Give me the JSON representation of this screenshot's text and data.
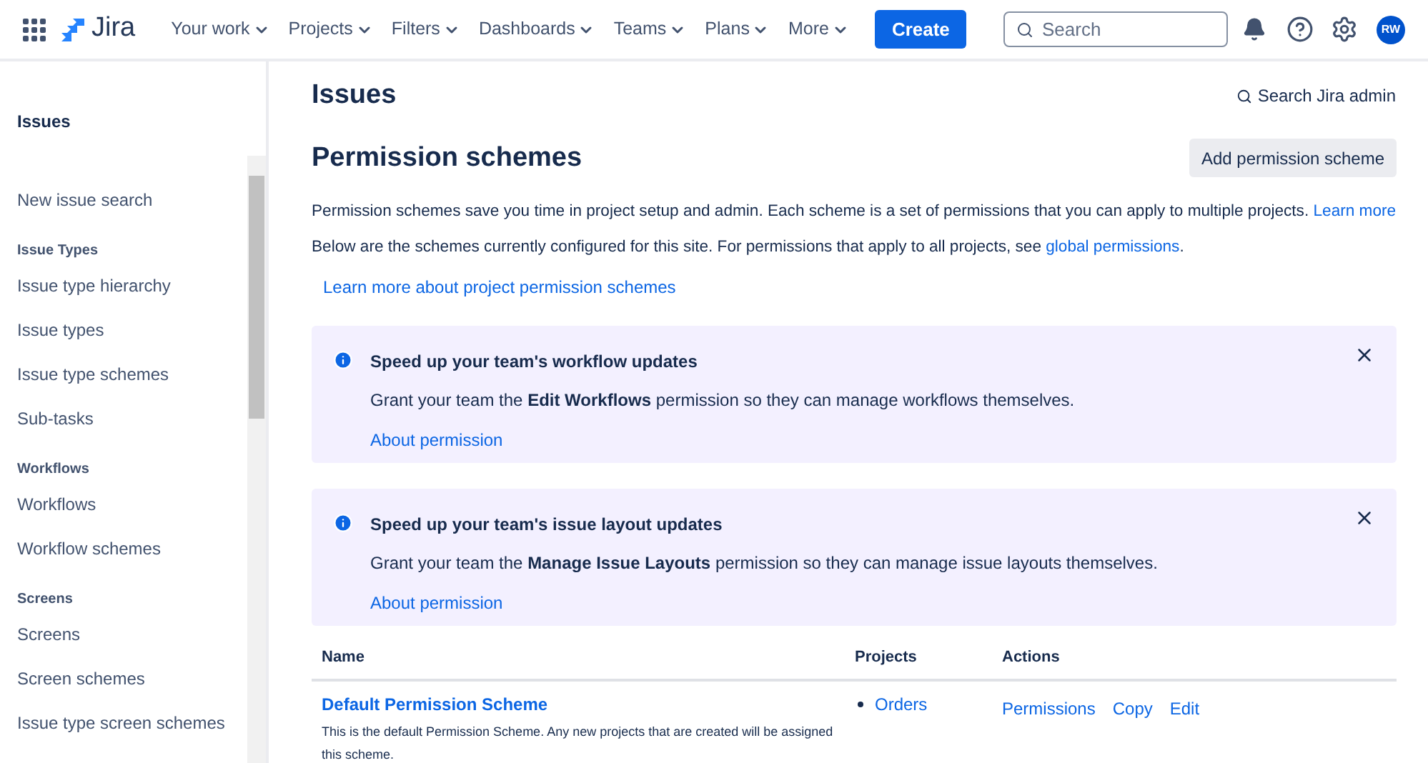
{
  "topbar": {
    "product": "Jira",
    "nav": [
      {
        "label": "Your work"
      },
      {
        "label": "Projects"
      },
      {
        "label": "Filters"
      },
      {
        "label": "Dashboards"
      },
      {
        "label": "Teams"
      },
      {
        "label": "Plans"
      },
      {
        "label": "More"
      }
    ],
    "create": "Create",
    "search": {
      "placeholder": "Search"
    },
    "avatar": "RW"
  },
  "sidebar": {
    "title": "Issues",
    "items": [
      {
        "kind": "link",
        "label": "New issue search"
      },
      {
        "kind": "heading",
        "label": "Issue Types"
      },
      {
        "kind": "link",
        "label": "Issue type hierarchy"
      },
      {
        "kind": "link",
        "label": "Issue types"
      },
      {
        "kind": "link",
        "label": "Issue type schemes"
      },
      {
        "kind": "link",
        "label": "Sub-tasks"
      },
      {
        "kind": "heading",
        "label": "Workflows"
      },
      {
        "kind": "link",
        "label": "Workflows"
      },
      {
        "kind": "link",
        "label": "Workflow schemes"
      },
      {
        "kind": "heading",
        "label": "Screens"
      },
      {
        "kind": "link",
        "label": "Screens"
      },
      {
        "kind": "link",
        "label": "Screen schemes"
      },
      {
        "kind": "link",
        "label": "Issue type screen schemes"
      }
    ]
  },
  "page": {
    "section": "Issues",
    "admin_search": "Search Jira admin",
    "title": "Permission schemes",
    "add_button": "Add permission scheme",
    "intro_1": "Permission schemes save you time in project setup and admin. Each scheme is a set of permissions that you can apply to multiple projects.",
    "intro_1_link": "Learn more",
    "intro_2": "Below are the schemes currently configured for this site. For permissions that apply to all projects, see",
    "intro_2_link": "global permissions",
    "intro_2_end": ".",
    "learn_link": "Learn more about project permission schemes"
  },
  "banners": [
    {
      "title": "Speed up your team's workflow updates",
      "text": "Grant your team the **Edit Workflows** permission so they can manage workflows themselves.",
      "link": "About permission"
    },
    {
      "title": "Speed up your team's issue layout updates",
      "text": "Grant your team the **Manage Issue Layouts** permission so they can manage issue layouts themselves.",
      "link": "About permission"
    }
  ],
  "table": {
    "columns": [
      "Name",
      "Projects",
      "Actions"
    ],
    "rows": [
      {
        "name": "Default Permission Scheme",
        "description": "This is the default Permission Scheme. Any new projects that are created will be assigned this scheme.",
        "projects": [
          "Orders"
        ],
        "actions": [
          "Permissions",
          "Copy",
          "Edit"
        ]
      }
    ]
  }
}
